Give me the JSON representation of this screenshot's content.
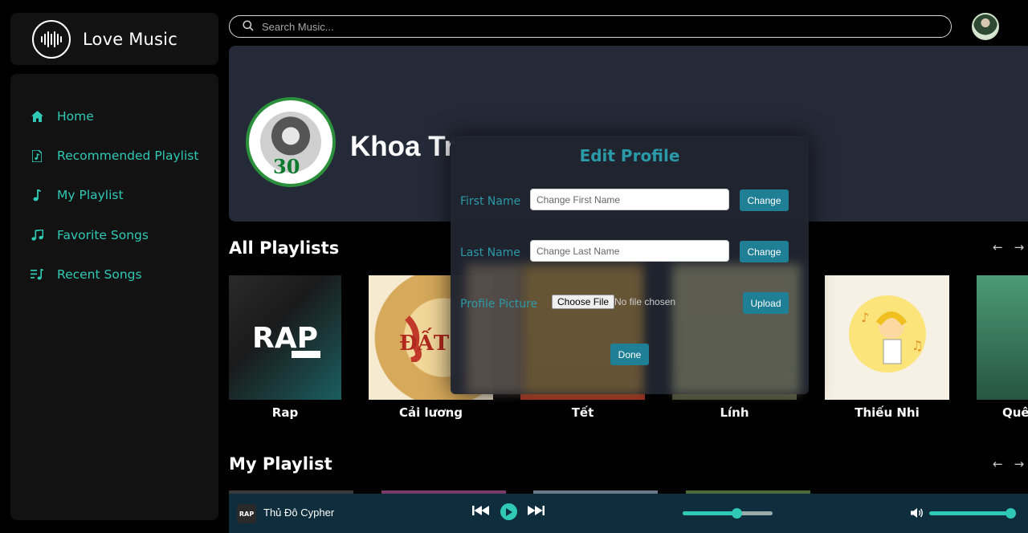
{
  "app": {
    "name": "Love Music"
  },
  "sidebar": {
    "items": [
      {
        "label": "Home",
        "icon": "home-icon"
      },
      {
        "label": "Recommended Playlist",
        "icon": "music-file-icon"
      },
      {
        "label": "My Playlist",
        "icon": "music-note-icon"
      },
      {
        "label": "Favorite Songs",
        "icon": "music-notes-icon"
      },
      {
        "label": "Recent Songs",
        "icon": "playlist-icon"
      }
    ]
  },
  "search": {
    "placeholder": "Search Music..."
  },
  "profile": {
    "name": "Khoa Tr"
  },
  "sections": {
    "all_playlists": "All Playlists",
    "my_playlist": "My Playlist"
  },
  "playlists": [
    {
      "label": "Rap",
      "color": "#1a1a1a"
    },
    {
      "label": "Cải lương",
      "color": "#e7c27a"
    },
    {
      "label": "Tết",
      "color": "#c0392b"
    },
    {
      "label": "Lính",
      "color": "#6b6b4a"
    },
    {
      "label": "Thiếu Nhi",
      "color": "#f6f1e4"
    },
    {
      "label": "Quê",
      "color": "#3f7d5c"
    }
  ],
  "modal": {
    "title": "Edit Profile",
    "first_name_label": "First Name",
    "first_name_placeholder": "Change First Name",
    "last_name_label": "Last Name",
    "last_name_placeholder": "Change Last Name",
    "change_label": "Change",
    "profile_picture_label": "Profile Picture",
    "choose_file_label": "Choose File",
    "no_file_text": "No file chosen",
    "upload_label": "Upload",
    "done_label": "Done"
  },
  "player": {
    "song_title": "Thủ Đô Cypher",
    "thumb_text": "RAP",
    "progress": 0.6,
    "volume": 1.0
  },
  "colors": {
    "accent": "#2fc9b5",
    "modal_title": "#2b9aa8",
    "button": "#1e7f95",
    "player_bg": "#0e2e3e",
    "banner_bg": "#252a38"
  }
}
